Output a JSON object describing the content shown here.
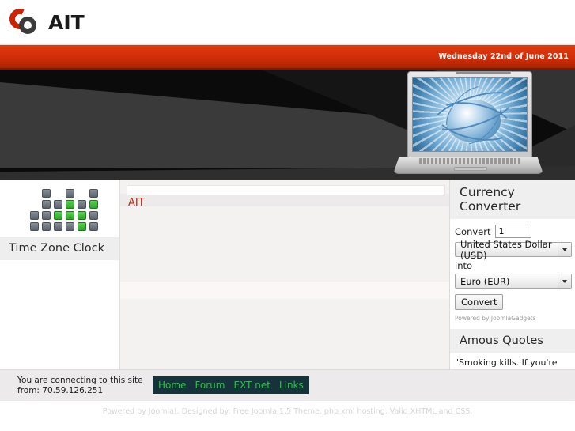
{
  "site": {
    "logo_text": "AIT",
    "logo_icon_red": "ring-icon",
    "logo_icon_dark": "ring-icon",
    "brand_red": "#cc2200",
    "brand_dark": "#3b3b3b"
  },
  "header": {
    "date": "Wednesday 22nd of June 2011",
    "band_color": "#d6300a"
  },
  "hero": {
    "image_name": "laptop-globe-banner",
    "background_color": "#0b0b0b",
    "screen_image_name": "blue-globe-network-rays"
  },
  "left_column": {
    "status_grid": {
      "name": "status-dot-grid",
      "on_color": "#2fa52b",
      "off_color": "#5d636c",
      "rows": [
        [
          "blank",
          "on_off",
          "blank",
          "on_off",
          "blank",
          "on_off"
        ],
        [
          "blank",
          "off",
          "off",
          "on",
          "off",
          "on"
        ],
        [
          "off",
          "off",
          "on",
          "on",
          "on",
          "off"
        ],
        [
          "off",
          "off",
          "off",
          "off",
          "on",
          "off"
        ]
      ]
    },
    "time_zone_clock": {
      "title": "Time Zone Clock"
    }
  },
  "main": {
    "pathway": "",
    "title": "AIT",
    "title_color": "#bb2a16"
  },
  "right_column": {
    "currency_converter": {
      "title": "Currency Converter",
      "convert_label": "Convert",
      "amount_value": "1",
      "amount_placeholder": "1",
      "from_currency": "United States Dollar (USD)",
      "into_label": "into",
      "to_currency": "Euro (EUR)",
      "button_label": "Convert",
      "credit": "Powered by JoomlaGadgets"
    },
    "quotes": {
      "title": "Amous Quotes",
      "text": "\"Smoking kills. If you're killed, you've lost a very important part of your life.\" -- Brooke Shields"
    }
  },
  "footer": {
    "ip_note_line1": "You are connecting to this site",
    "ip_note_line2": "from: 70.59.126.251",
    "nav": [
      {
        "label": "Home"
      },
      {
        "label": "Forum"
      },
      {
        "label": "EXT net"
      },
      {
        "label": "Links"
      }
    ],
    "nav_bg": "#16333c",
    "nav_link_color": "#25c63e",
    "credits": "Powered by Joomla!. Designed by: Free Joomla 1.5 Theme. php xml hosting. Valid XHTML and CSS."
  }
}
